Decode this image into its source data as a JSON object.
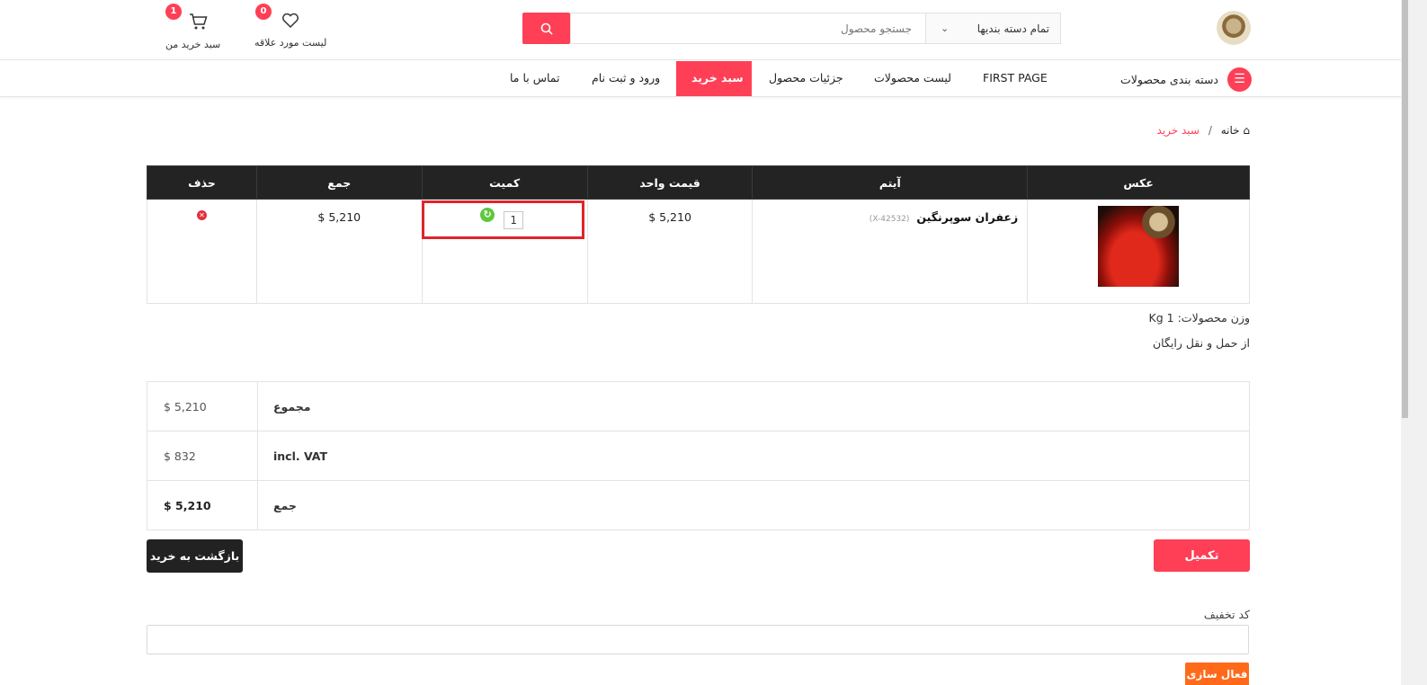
{
  "header": {
    "search": {
      "placeholder": "جستجو محصول",
      "category": "تمام دسته بندیها"
    },
    "wishlist": {
      "count": "0",
      "label": "لیست مورد علاقه"
    },
    "cart": {
      "count": "1",
      "label": "سبد خرید من"
    }
  },
  "nav": {
    "category_toggle": "دسته بندی محصولات",
    "items": [
      {
        "label": "FIRST PAGE"
      },
      {
        "label": "لیست محصولات"
      },
      {
        "label": "جزئیات محصول"
      },
      {
        "label": "سبد خرید",
        "active": true
      },
      {
        "label": "ورود و ثبت نام"
      },
      {
        "label": "تماس با ما"
      }
    ]
  },
  "breadcrumb": {
    "home": "خانه",
    "separator": "/",
    "current": "سبد خرید"
  },
  "cart_table": {
    "headers": {
      "image": "عکس",
      "item": "آیتم",
      "unit_price": "قیمت واحد",
      "quantity": "کمیت",
      "total": "جمع",
      "remove": "حذف"
    },
    "rows": [
      {
        "name": "زعفران سوپرنگین",
        "sku": "(X-42532)",
        "unit_price": "$ 5,210",
        "quantity": "1",
        "total": "$ 5,210"
      }
    ]
  },
  "weight_text": "وزن محصولات: 1 Kg",
  "shipping_text": "از حمل و نقل رایگان",
  "totals": {
    "rows": [
      {
        "label": "مجموع",
        "value": "$ 5,210"
      },
      {
        "label": "incl. VAT",
        "value": "$ 832"
      },
      {
        "label": "جمع",
        "value": "$ 5,210"
      }
    ]
  },
  "buttons": {
    "complete": "تکمیل",
    "back": "بازگشت به خرید",
    "activate": "فعال سازی"
  },
  "coupon": {
    "label": "کد تخفیف",
    "value": ""
  },
  "colors": {
    "accent": "#ff3f56",
    "dark": "#232323",
    "orange": "#ff6a1a",
    "highlight": "#e0242b"
  }
}
